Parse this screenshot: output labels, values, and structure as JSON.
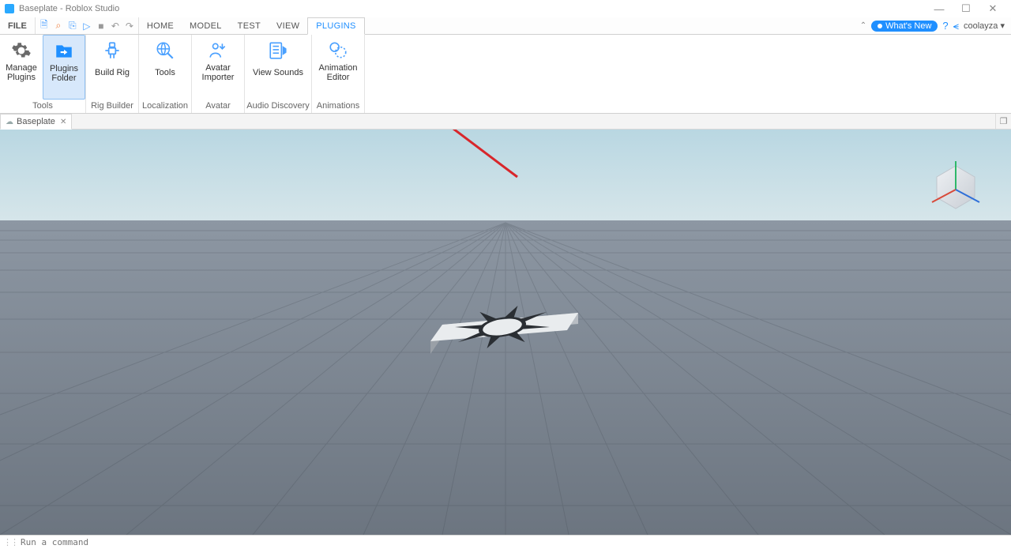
{
  "window": {
    "title": "Baseplate - Roblox Studio"
  },
  "menu": {
    "file": "FILE",
    "tabs": [
      "HOME",
      "MODEL",
      "TEST",
      "VIEW",
      "PLUGINS"
    ],
    "active_tab": "PLUGINS",
    "whats_new": "What's New",
    "user": "coolayza"
  },
  "ribbon": {
    "groups": [
      {
        "label": "Tools",
        "buttons": [
          {
            "name": "manage-plugins",
            "label": "Manage Plugins"
          },
          {
            "name": "plugins-folder",
            "label": "Plugins Folder",
            "selected": true
          }
        ]
      },
      {
        "label": "Rig Builder",
        "buttons": [
          {
            "name": "build-rig",
            "label": "Build Rig"
          }
        ]
      },
      {
        "label": "Localization",
        "buttons": [
          {
            "name": "tools",
            "label": "Tools"
          }
        ]
      },
      {
        "label": "Avatar",
        "buttons": [
          {
            "name": "avatar-importer",
            "label": "Avatar Importer"
          }
        ]
      },
      {
        "label": "Audio Discovery",
        "buttons": [
          {
            "name": "view-sounds",
            "label": "View Sounds"
          }
        ]
      },
      {
        "label": "Animations",
        "buttons": [
          {
            "name": "animation-editor",
            "label": "Animation Editor"
          }
        ]
      }
    ]
  },
  "doc_tab": {
    "title": "Baseplate"
  },
  "command_bar": {
    "placeholder": "Run a command"
  },
  "annotation": {
    "arrow_color": "#d8262b"
  },
  "colors": {
    "accent": "#1f8fff",
    "icon": "#4aa0ff"
  }
}
